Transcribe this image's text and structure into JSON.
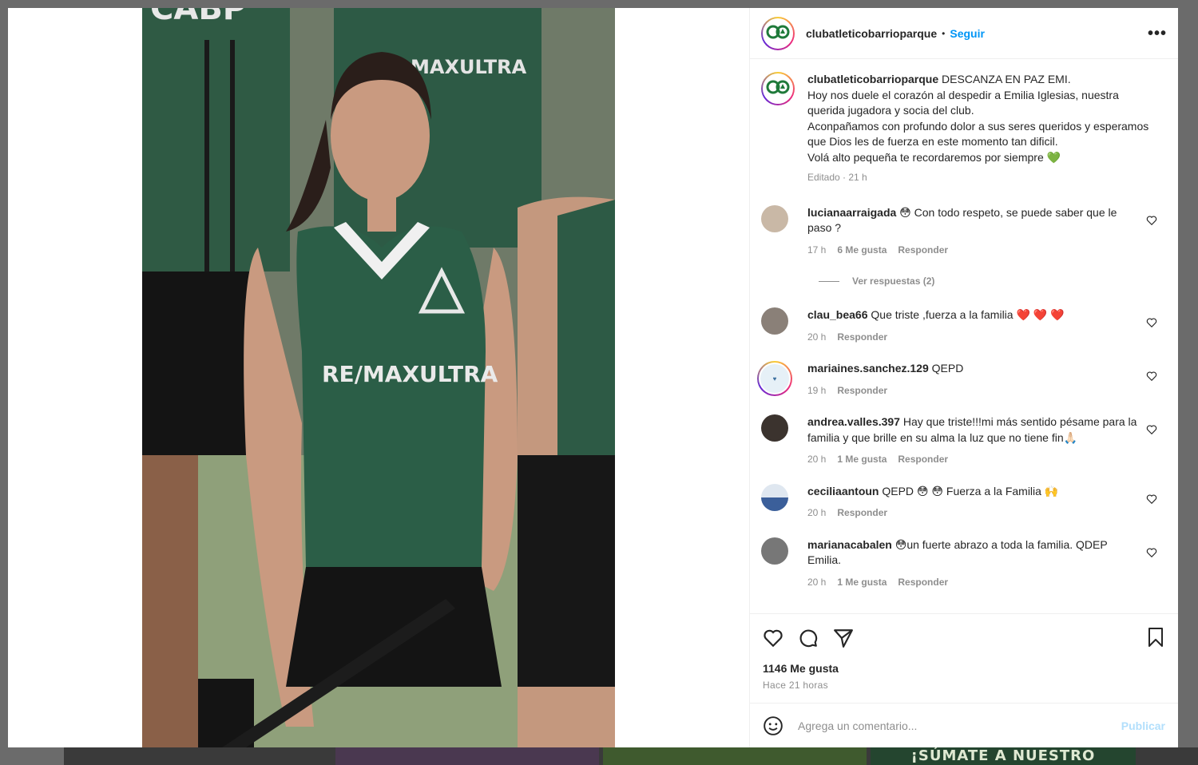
{
  "background": {
    "banner_text": "¡SÚMATE A NUESTRO"
  },
  "photo": {
    "jersey_sponsor": "RE/MAXULTRA",
    "jersey_logo": "CABP",
    "shirt_back_text": "CABP"
  },
  "post": {
    "username": "clubatleticobarrioparque",
    "follow_label": "Seguir",
    "separator": "•",
    "more_label": "•••",
    "caption_lines": [
      "DESCANZA EN PAZ EMI.",
      "Hoy nos duele el corazón al despedir a Emilia Iglesias, nuestra querida jugadora y socia del club.",
      "Aconpañamos con profundo dolor a sus seres queridos y esperamos que Dios les de fuerza en este momento tan dificil.",
      "Volá alto pequeña te recordaremos por siempre"
    ],
    "caption_emoji": "💚",
    "caption_meta": "Editado · 21 h",
    "likes": "1146 Me gusta",
    "time_ago": "Hace 21 horas",
    "comment_placeholder": "Agrega un comentario...",
    "publish_label": "Publicar"
  },
  "comments": [
    {
      "user": "lucianaarraigada",
      "text": "😳 Con todo respeto, se puede saber que le paso ?",
      "time": "17 h",
      "likes": "6 Me gusta",
      "reply": "Responder",
      "view_replies": "Ver respuestas (2)",
      "avatar_color": "#c9b8a6"
    },
    {
      "user": "clau_bea66",
      "text": "Que triste ,fuerza a la familia ❤️ ❤️ ❤️",
      "time": "20 h",
      "likes": "",
      "reply": "Responder",
      "avatar_color": "#8a8078"
    },
    {
      "user": "mariaines.sanchez.129",
      "text": "QEPD",
      "time": "19 h",
      "likes": "",
      "reply": "Responder",
      "avatar_color": "#e6f0f7"
    },
    {
      "user": "andrea.valles.397",
      "text": "Hay que triste!!!mi más sentido pésame para la familia y que brille en su alma la luz que no tiene fin🙏🏻",
      "time": "20 h",
      "likes": "1 Me gusta",
      "reply": "Responder",
      "avatar_color": "#3b332e"
    },
    {
      "user": "ceciliaantoun",
      "text": "QEPD 😳 😳 Fuerza a la Familia 🙌",
      "time": "20 h",
      "likes": "",
      "reply": "Responder",
      "avatar_color": "#3b5f9a"
    },
    {
      "user": "marianacabalen",
      "text": "😳un fuerte abrazo a toda la familia. QDEP Emilia.",
      "time": "20 h",
      "likes": "1 Me gusta",
      "reply": "Responder",
      "avatar_color": "#777777"
    }
  ]
}
